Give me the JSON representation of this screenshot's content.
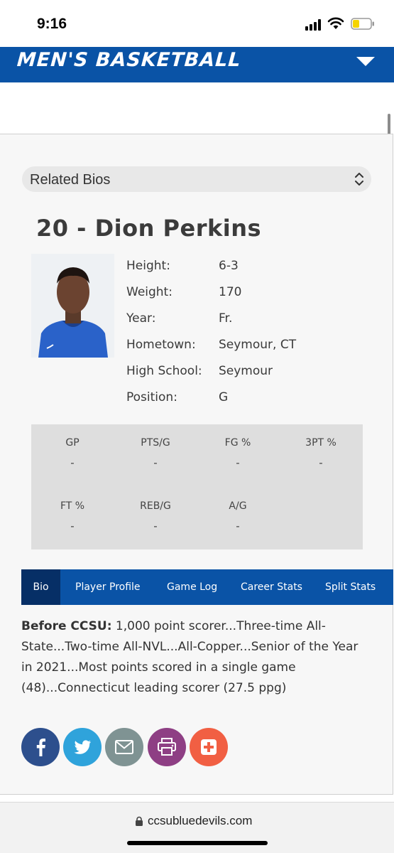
{
  "status_bar": {
    "time": "9:16"
  },
  "header": {
    "title": "MEN'S BASKETBALL"
  },
  "related": {
    "label": "Related Bios"
  },
  "player": {
    "title": "20 - Dion Perkins",
    "info": [
      {
        "label": "Height:",
        "value": "6-3"
      },
      {
        "label": "Weight:",
        "value": "170"
      },
      {
        "label": "Year:",
        "value": "Fr."
      },
      {
        "label": "Hometown:",
        "value": "Seymour, CT"
      },
      {
        "label": "High School:",
        "value": "Seymour"
      },
      {
        "label": "Position:",
        "value": "G"
      }
    ]
  },
  "stats": [
    {
      "label": "GP",
      "value": "-"
    },
    {
      "label": "PTS/G",
      "value": "-"
    },
    {
      "label": "FG %",
      "value": "-"
    },
    {
      "label": "3PT %",
      "value": "-"
    },
    {
      "label": "FT %",
      "value": "-"
    },
    {
      "label": "REB/G",
      "value": "-"
    },
    {
      "label": "A/G",
      "value": "-"
    }
  ],
  "tabs": [
    {
      "label": "Bio"
    },
    {
      "label": "Player Profile"
    },
    {
      "label": "Game Log"
    },
    {
      "label": "Career Stats"
    },
    {
      "label": "Split Stats"
    }
  ],
  "bio": {
    "lead": "Before CCSU:",
    "text": " 1,000 point scorer...Three-time All-State...Two-time All-NVL...All-Copper...Senior of the Year in 2021...Most points scored in a single game (48)...Connecticut leading scorer (27.5 ppg)"
  },
  "share": [
    {
      "icon": "facebook-icon",
      "color": "#2d4f8d"
    },
    {
      "icon": "twitter-icon",
      "color": "#2fa3db"
    },
    {
      "icon": "email-icon",
      "color": "#7f9393"
    },
    {
      "icon": "print-icon",
      "color": "#8e3f84"
    },
    {
      "icon": "add-icon",
      "color": "#f15f43"
    }
  ],
  "browser": {
    "url": "ccsubluedevils.com"
  },
  "colors": {
    "brand_blue": "#0a53a6",
    "active_tab": "#062f66"
  }
}
